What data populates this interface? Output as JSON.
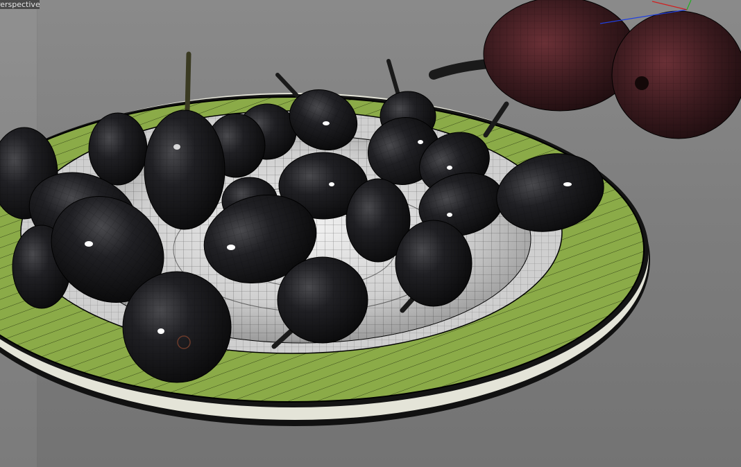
{
  "viewport": {
    "label": "Perspective",
    "background_color": "#7e7e7e",
    "plate_color": "#8bab48",
    "bowl_color": "#d9d9d9",
    "grape_color": "#1c1c1e",
    "plum_color": "#3a1a1e",
    "axis_colors": {
      "x": "#d02020",
      "y": "#20b020",
      "z": "#2040e0"
    }
  },
  "scene": {
    "objects": [
      "plate",
      "bowl",
      "grapes",
      "plums"
    ]
  }
}
